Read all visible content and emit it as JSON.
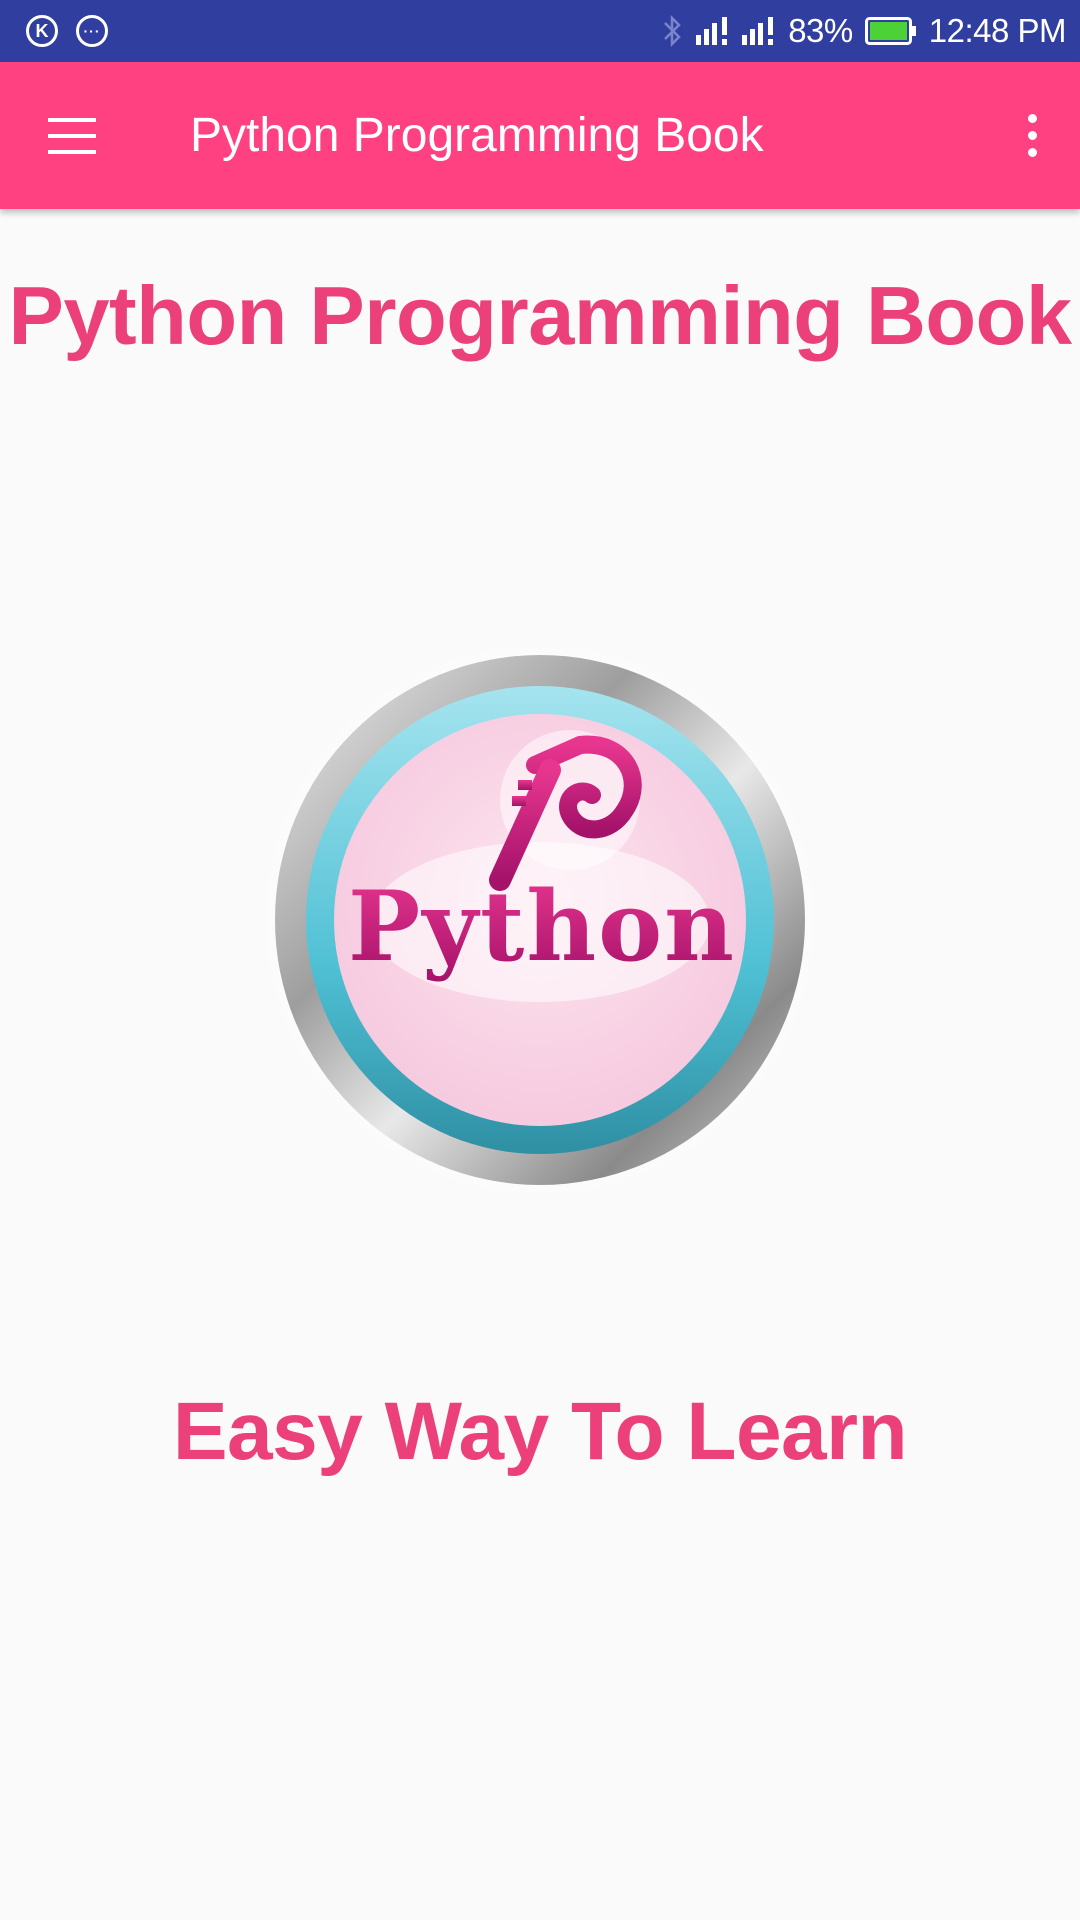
{
  "status_bar": {
    "battery": "83%",
    "time": "12:48 PM",
    "icons": [
      "k-app-icon",
      "chat-bubble-icon",
      "bluetooth-icon",
      "signal-icon",
      "signal-icon",
      "battery-icon"
    ]
  },
  "app_bar": {
    "title": "Python Programming Book",
    "background": "#ff4081"
  },
  "content": {
    "heading": "Python Programming Book",
    "logo_text": "Python",
    "tagline": "Easy Way To Learn",
    "accent": "#ec407a"
  }
}
